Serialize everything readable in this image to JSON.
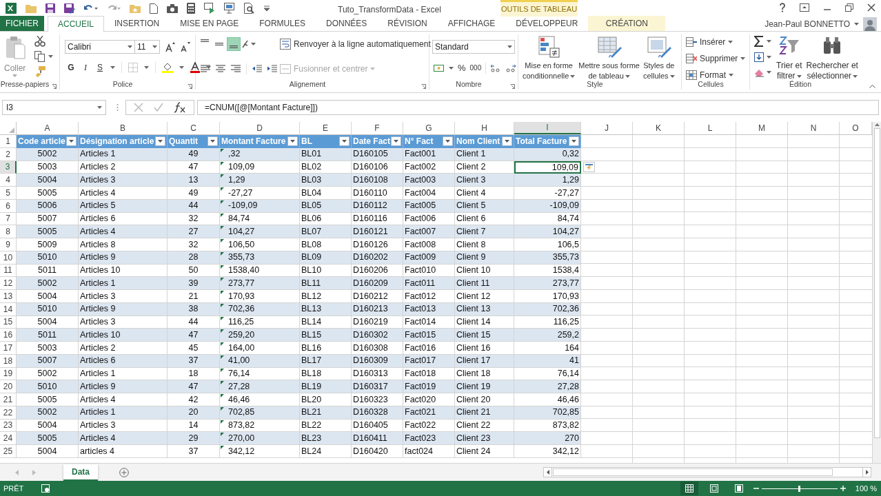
{
  "window": {
    "title": "Tuto_TransformData - Excel",
    "context_label": "OUTILS DE TABLEAU"
  },
  "tabs": [
    {
      "label": "FICHIER",
      "kind": "file",
      "selected": false
    },
    {
      "label": "ACCUEIL",
      "kind": "tab",
      "selected": true
    },
    {
      "label": "INSERTION",
      "kind": "tab",
      "selected": false
    },
    {
      "label": "MISE EN PAGE",
      "kind": "tab",
      "selected": false
    },
    {
      "label": "FORMULES",
      "kind": "tab",
      "selected": false
    },
    {
      "label": "DONNÉES",
      "kind": "tab",
      "selected": false
    },
    {
      "label": "RÉVISION",
      "kind": "tab",
      "selected": false
    },
    {
      "label": "AFFICHAGE",
      "kind": "tab",
      "selected": false
    },
    {
      "label": "DÉVELOPPEUR",
      "kind": "tab",
      "selected": false
    },
    {
      "label": "CRÉATION",
      "kind": "context",
      "selected": false
    }
  ],
  "user": {
    "name": "Jean-Paul BONNETTO"
  },
  "ribbon": {
    "groups": [
      {
        "label": "Presse-papiers",
        "paste": "Coller"
      },
      {
        "label": "Police",
        "font": "Calibri",
        "size": "11",
        "bold": "G",
        "italic": "I",
        "underline": "S"
      },
      {
        "label": "Alignement",
        "vertical_align": [
          {
            "selected": false
          },
          {
            "selected": false
          },
          {
            "selected": true
          }
        ],
        "wrap": "Renvoyer à la ligne automatiquement",
        "merge": {
          "label": "Fusionner et centrer",
          "disabled": true
        }
      },
      {
        "label": "Nombre",
        "format": "Standard",
        "percent": "%",
        "thousands": "000"
      },
      {
        "label": "Style",
        "buttons": [
          [
            "Mise en forme",
            "conditionnelle"
          ],
          [
            "Mettre sous forme",
            "de tableau"
          ],
          [
            "Styles de",
            "cellules"
          ]
        ]
      },
      {
        "label": "Cellules",
        "buttons": [
          "Insérer",
          "Supprimer",
          "Format"
        ]
      },
      {
        "label": "Édition",
        "buttons": [
          [
            "Trier et",
            "filtrer"
          ],
          [
            "Rechercher et",
            "sélectionner"
          ]
        ]
      }
    ]
  },
  "formula_bar": {
    "name_box": "I3",
    "formula": "=CNUM([@[Montant Facture]])"
  },
  "columns": [
    {
      "label": "A",
      "selected": false
    },
    {
      "label": "B",
      "selected": false
    },
    {
      "label": "C",
      "selected": false
    },
    {
      "label": "D",
      "selected": false
    },
    {
      "label": "E",
      "selected": false
    },
    {
      "label": "F",
      "selected": false
    },
    {
      "label": "G",
      "selected": false
    },
    {
      "label": "H",
      "selected": false
    },
    {
      "label": "I",
      "selected": true
    },
    {
      "label": "J",
      "selected": false
    },
    {
      "label": "K",
      "selected": false
    },
    {
      "label": "L",
      "selected": false
    },
    {
      "label": "M",
      "selected": false
    },
    {
      "label": "N",
      "selected": false
    },
    {
      "label": "O",
      "selected": false
    }
  ],
  "table": {
    "header_row": "1",
    "headers": [
      "Code article",
      "Désignation article",
      "Quantit",
      "Montant Facture",
      "BL",
      "Date Fact",
      "N° Fact",
      "Nom Client",
      "Total Facture"
    ],
    "rows": [
      {
        "number": "2",
        "selected": false,
        "flagged": true,
        "cells": [
          "5002",
          "Articles 1",
          "49",
          ",32",
          "BL01",
          "D160105",
          "Fact001",
          "Client 1",
          "0,32"
        ]
      },
      {
        "number": "3",
        "selected": true,
        "flagged": true,
        "cells": [
          "5003",
          "Articles 2",
          "47",
          "109,09",
          "BL02",
          "D160106",
          "Fact002",
          "Client 2",
          "109,09"
        ]
      },
      {
        "number": "4",
        "selected": false,
        "flagged": true,
        "cells": [
          "5004",
          "Articles 3",
          "13",
          "1,29",
          "BL03",
          "D160108",
          "Fact003",
          "Client 3",
          "1,29"
        ]
      },
      {
        "number": "5",
        "selected": false,
        "flagged": true,
        "cells": [
          "5005",
          "Articles 4",
          "49",
          "-27,27",
          "BL04",
          "D160110",
          "Fact004",
          "Client 4",
          "-27,27"
        ]
      },
      {
        "number": "6",
        "selected": false,
        "flagged": true,
        "cells": [
          "5006",
          "Articles 5",
          "44",
          "-109,09",
          "BL05",
          "D160112",
          "Fact005",
          "Client 5",
          "-109,09"
        ]
      },
      {
        "number": "7",
        "selected": false,
        "flagged": true,
        "cells": [
          "5007",
          "Articles 6",
          "32",
          "84,74",
          "BL06",
          "D160116",
          "Fact006",
          "Client 6",
          "84,74"
        ]
      },
      {
        "number": "8",
        "selected": false,
        "flagged": true,
        "cells": [
          "5005",
          "Articles 4",
          "27",
          "104,27",
          "BL07",
          "D160121",
          "Fact007",
          "Client 7",
          "104,27"
        ]
      },
      {
        "number": "9",
        "selected": false,
        "flagged": true,
        "cells": [
          "5009",
          "Articles 8",
          "32",
          "106,50",
          "BL08",
          "D160126",
          "Fact008",
          "Client 8",
          "106,5"
        ]
      },
      {
        "number": "10",
        "selected": false,
        "flagged": true,
        "cells": [
          "5010",
          "Articles 9",
          "28",
          "355,73",
          "BL09",
          "D160202",
          "Fact009",
          "Client 9",
          "355,73"
        ]
      },
      {
        "number": "11",
        "selected": false,
        "flagged": true,
        "cells": [
          "5011",
          "Articles 10",
          "50",
          "1538,40",
          "BL10",
          "D160206",
          "Fact010",
          "Client 10",
          "1538,4"
        ]
      },
      {
        "number": "12",
        "selected": false,
        "flagged": true,
        "cells": [
          "5002",
          "Articles 1",
          "39",
          "273,77",
          "BL11",
          "D160209",
          "Fact011",
          "Client 11",
          "273,77"
        ]
      },
      {
        "number": "13",
        "selected": false,
        "flagged": true,
        "cells": [
          "5004",
          "Articles 3",
          "21",
          "170,93",
          "BL12",
          "D160212",
          "Fact012",
          "Client 12",
          "170,93"
        ]
      },
      {
        "number": "14",
        "selected": false,
        "flagged": true,
        "cells": [
          "5010",
          "Articles 9",
          "38",
          "702,36",
          "BL13",
          "D160213",
          "Fact013",
          "Client 13",
          "702,36"
        ]
      },
      {
        "number": "15",
        "selected": false,
        "flagged": true,
        "cells": [
          "5004",
          "Articles 3",
          "44",
          "116,25",
          "BL14",
          "D160219",
          "Fact014",
          "Client 14",
          "116,25"
        ]
      },
      {
        "number": "16",
        "selected": false,
        "flagged": true,
        "cells": [
          "5011",
          "Articles 10",
          "47",
          "259,20",
          "BL15",
          "D160302",
          "Fact015",
          "Client 15",
          "259,2"
        ]
      },
      {
        "number": "17",
        "selected": false,
        "flagged": true,
        "cells": [
          "5003",
          "Articles 2",
          "45",
          "164,00",
          "BL16",
          "D160308",
          "Fact016",
          "Client 16",
          "164"
        ]
      },
      {
        "number": "18",
        "selected": false,
        "flagged": true,
        "cells": [
          "5007",
          "Articles 6",
          "37",
          "41,00",
          "BL17",
          "D160309",
          "Fact017",
          "Client 17",
          "41"
        ]
      },
      {
        "number": "19",
        "selected": false,
        "flagged": true,
        "cells": [
          "5002",
          "Articles 1",
          "18",
          "76,14",
          "BL18",
          "D160313",
          "Fact018",
          "Client 18",
          "76,14"
        ]
      },
      {
        "number": "20",
        "selected": false,
        "flagged": true,
        "cells": [
          "5010",
          "Articles 9",
          "47",
          "27,28",
          "BL19",
          "D160317",
          "Fact019",
          "Client 19",
          "27,28"
        ]
      },
      {
        "number": "21",
        "selected": false,
        "flagged": true,
        "cells": [
          "5005",
          "Articles 4",
          "42",
          "46,46",
          "BL20",
          "D160323",
          "Fact020",
          "Client 20",
          "46,46"
        ]
      },
      {
        "number": "22",
        "selected": false,
        "flagged": true,
        "cells": [
          "5002",
          "Articles 1",
          "20",
          "702,85",
          "BL21",
          "D160328",
          "Fact021",
          "Client 21",
          "702,85"
        ]
      },
      {
        "number": "23",
        "selected": false,
        "flagged": true,
        "cells": [
          "5004",
          "Articles 3",
          "14",
          "873,82",
          "BL22",
          "D160405",
          "Fact022",
          "Client 22",
          "873,82"
        ]
      },
      {
        "number": "24",
        "selected": false,
        "flagged": true,
        "cells": [
          "5005",
          "Articles 4",
          "29",
          "270,00",
          "BL23",
          "D160411",
          "Fact023",
          "Client 23",
          "270"
        ]
      },
      {
        "number": "25",
        "selected": false,
        "flagged": true,
        "cells": [
          "5004",
          "articles 4",
          "37",
          "342,12",
          "BL24",
          "D160420",
          "fact024",
          "Client 24",
          "342,12"
        ]
      }
    ]
  },
  "sheets": [
    {
      "label": "Data",
      "selected": true
    }
  ],
  "status_bar": {
    "status": "PRÊT",
    "views": [
      {
        "selected": true
      },
      {
        "selected": false
      },
      {
        "selected": false
      }
    ],
    "zoom": {
      "level": 0.5,
      "reading": "100 %"
    }
  }
}
